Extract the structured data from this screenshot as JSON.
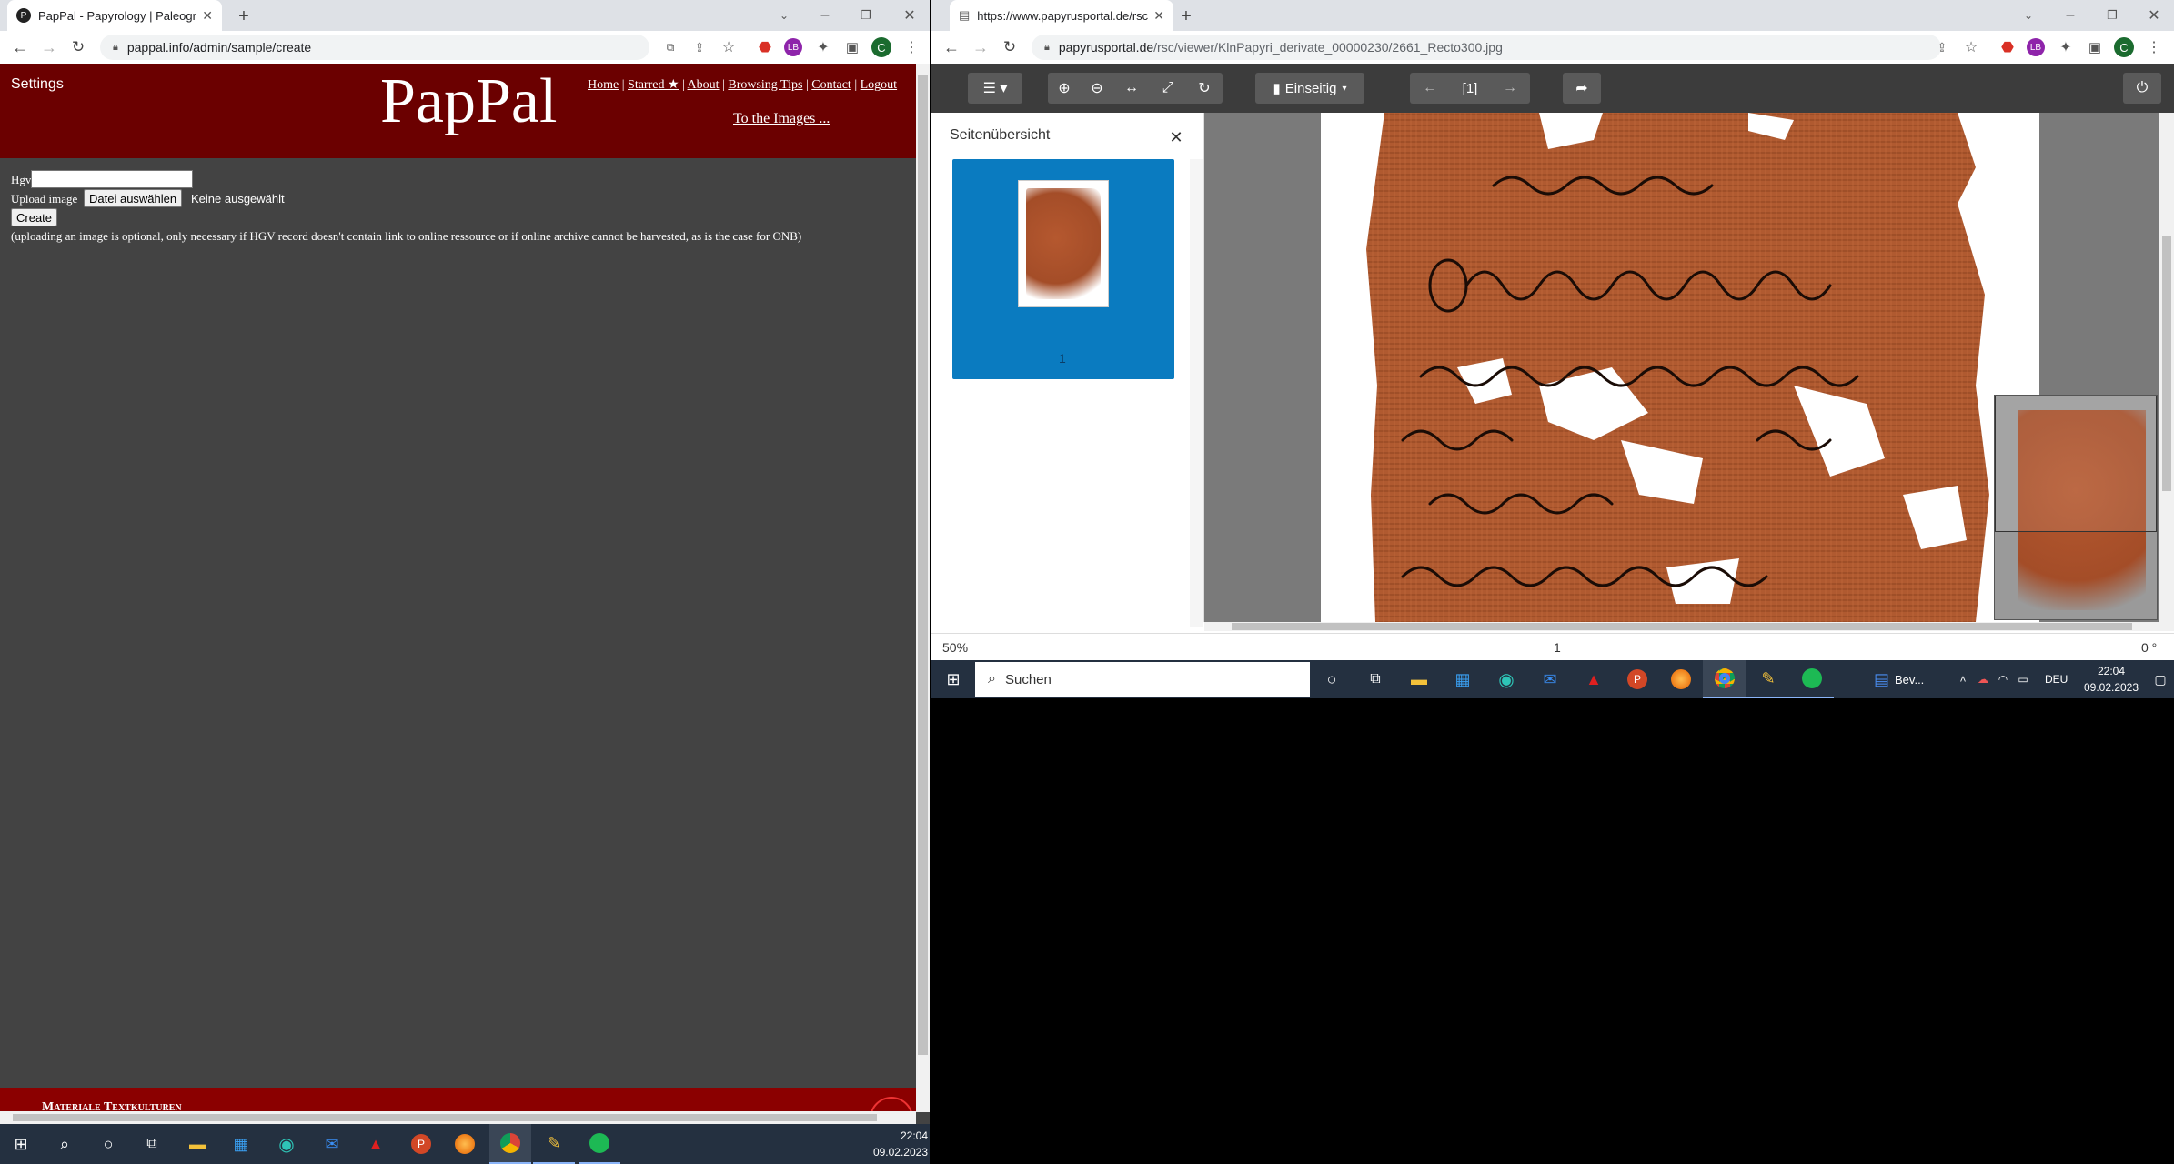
{
  "left_browser": {
    "tab_title": "PapPal - Papyrology | Paleograph",
    "url": "pappal.info/admin/sample/create",
    "avatar_letter": "C"
  },
  "right_browser": {
    "tab_title": "https://www.papyrusportal.de/rsc",
    "url_host": "papyrusportal.de",
    "url_path": "/rsc/viewer/KlnPapyri_derivate_00000230/2661_Recto300.jpg",
    "avatar_letter": "C"
  },
  "pappal": {
    "settings": "Settings",
    "logo": "PapPal",
    "nav": [
      "Home",
      "Starred ★",
      "About",
      "Browsing Tips",
      "Contact",
      "Logout"
    ],
    "to_images": "To the Images ...",
    "hgv_label": "Hgv",
    "hgv_value": "",
    "upload_label": "Upload image",
    "file_button": "Datei auswählen",
    "file_status": "Keine ausgewählt",
    "create_button": "Create",
    "note": "(uploading an image is optional, only necessary if HGV record doesn't contain link to online ressource or if online archive cannot be harvested, as is the case for ONB)",
    "footer": "Materiale Textkulturen"
  },
  "viewer": {
    "mode_label": "Einseitig",
    "page_indicator": "[1]",
    "sidebar_title": "Seitenübersicht",
    "thumb_page": "1",
    "zoom": "50%",
    "page_number": "1",
    "rotation": "0 °"
  },
  "taskbar_right": {
    "search_label": "Suchen",
    "pinned_doc": "Bev...",
    "lang": "DEU",
    "time": "22:04",
    "date": "09.02.2023"
  },
  "taskbar_left": {
    "time": "22:04",
    "date": "09.02.2023"
  },
  "colors": {
    "pappal_red": "#6b0000",
    "page_bg": "#434343",
    "thumb_blue": "#0a7bc0",
    "papyrus": "#b5582f"
  }
}
